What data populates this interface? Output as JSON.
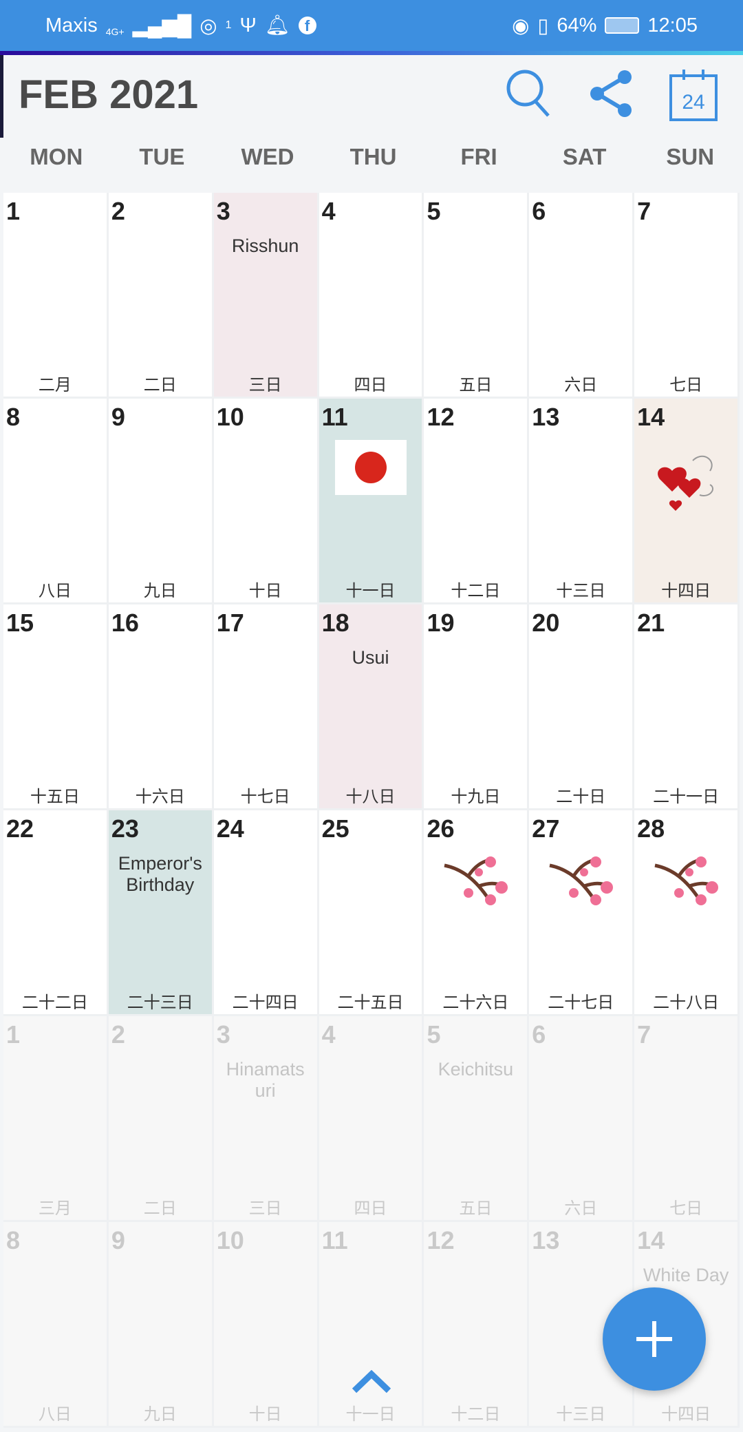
{
  "status_bar": {
    "carrier": "Maxis",
    "network": "4G+",
    "hotspot_count": "1",
    "battery": "64%",
    "time": "12:05"
  },
  "header": {
    "title": "FEB 2021",
    "today_icon_day": "24"
  },
  "weekdays": [
    "MON",
    "TUE",
    "WED",
    "THU",
    "FRI",
    "SAT",
    "SUN"
  ],
  "colors": {
    "accent": "#3d8fe0",
    "holiday_pink": "#f3e9ec",
    "holiday_teal": "#d6e5e4",
    "valentine_beige": "#f5eee8"
  },
  "weeks": [
    [
      {
        "d": "1",
        "l": "二月"
      },
      {
        "d": "2",
        "l": "二日"
      },
      {
        "d": "3",
        "l": "三日",
        "e": "Risshun",
        "bg": "#f3e9ec"
      },
      {
        "d": "4",
        "l": "四日"
      },
      {
        "d": "5",
        "l": "五日"
      },
      {
        "d": "6",
        "l": "六日"
      },
      {
        "d": "7",
        "l": "七日"
      }
    ],
    [
      {
        "d": "8",
        "l": "八日"
      },
      {
        "d": "9",
        "l": "九日"
      },
      {
        "d": "10",
        "l": "十日"
      },
      {
        "d": "11",
        "l": "十一日",
        "bg": "#d6e5e4",
        "icon": "japan-flag"
      },
      {
        "d": "12",
        "l": "十二日"
      },
      {
        "d": "13",
        "l": "十三日"
      },
      {
        "d": "14",
        "l": "十四日",
        "bg": "#f5eee8",
        "icon": "hearts"
      }
    ],
    [
      {
        "d": "15",
        "l": "十五日"
      },
      {
        "d": "16",
        "l": "十六日"
      },
      {
        "d": "17",
        "l": "十七日"
      },
      {
        "d": "18",
        "l": "十八日",
        "e": "Usui",
        "bg": "#f3e9ec"
      },
      {
        "d": "19",
        "l": "十九日"
      },
      {
        "d": "20",
        "l": "二十日"
      },
      {
        "d": "21",
        "l": "二十一日"
      }
    ],
    [
      {
        "d": "22",
        "l": "二十二日"
      },
      {
        "d": "23",
        "l": "二十三日",
        "e": "Emperor's Birthday",
        "bg": "#d6e5e4"
      },
      {
        "d": "24",
        "l": "二十四日"
      },
      {
        "d": "25",
        "l": "二十五日"
      },
      {
        "d": "26",
        "l": "二十六日",
        "icon": "cherry-blossom"
      },
      {
        "d": "27",
        "l": "二十七日",
        "icon": "cherry-blossom"
      },
      {
        "d": "28",
        "l": "二十八日",
        "icon": "cherry-blossom"
      }
    ],
    [
      {
        "d": "1",
        "l": "三月",
        "n": true
      },
      {
        "d": "2",
        "l": "二日",
        "n": true
      },
      {
        "d": "3",
        "l": "三日",
        "e": "Hinamats uri",
        "n": true
      },
      {
        "d": "4",
        "l": "四日",
        "n": true
      },
      {
        "d": "5",
        "l": "五日",
        "e": "Keichitsu",
        "n": true
      },
      {
        "d": "6",
        "l": "六日",
        "n": true
      },
      {
        "d": "7",
        "l": "七日",
        "n": true
      }
    ],
    [
      {
        "d": "8",
        "l": "八日",
        "n": true
      },
      {
        "d": "9",
        "l": "九日",
        "n": true
      },
      {
        "d": "10",
        "l": "十日",
        "n": true
      },
      {
        "d": "11",
        "l": "十一日",
        "n": true
      },
      {
        "d": "12",
        "l": "十二日",
        "n": true
      },
      {
        "d": "13",
        "l": "十三日",
        "n": true
      },
      {
        "d": "14",
        "l": "十四日",
        "e": "White Day",
        "n": true
      }
    ]
  ]
}
